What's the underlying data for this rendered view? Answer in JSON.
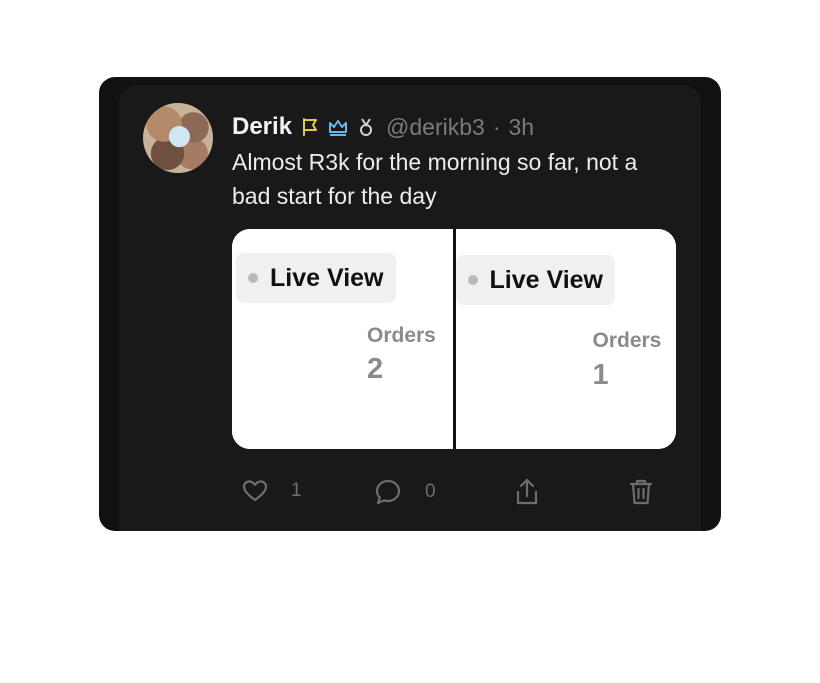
{
  "post": {
    "author_name": "Derik",
    "handle": "@derikb3",
    "separator": "·",
    "time": "3h",
    "text": "Almost R3k for the morning so far, not a bad start for the day",
    "badges": [
      {
        "name": "flag-icon",
        "color": "#e6c84b"
      },
      {
        "name": "crown-icon",
        "color": "#6cb6e8"
      },
      {
        "name": "medal-icon",
        "color": "#d0d0d0"
      }
    ]
  },
  "media": {
    "left_panel": {
      "pill_label": "Live View",
      "orders_label": "Orders",
      "orders_value": "2"
    },
    "right_panel": {
      "pill_label": "Live View",
      "orders_label": "Orders",
      "orders_value": "1"
    }
  },
  "actions": {
    "like_count": "1",
    "reply_count": "0"
  },
  "colors": {
    "background": "#111111",
    "card": "#191919",
    "text_primary": "#f4f4f4",
    "text_secondary": "#7b7b7b"
  }
}
